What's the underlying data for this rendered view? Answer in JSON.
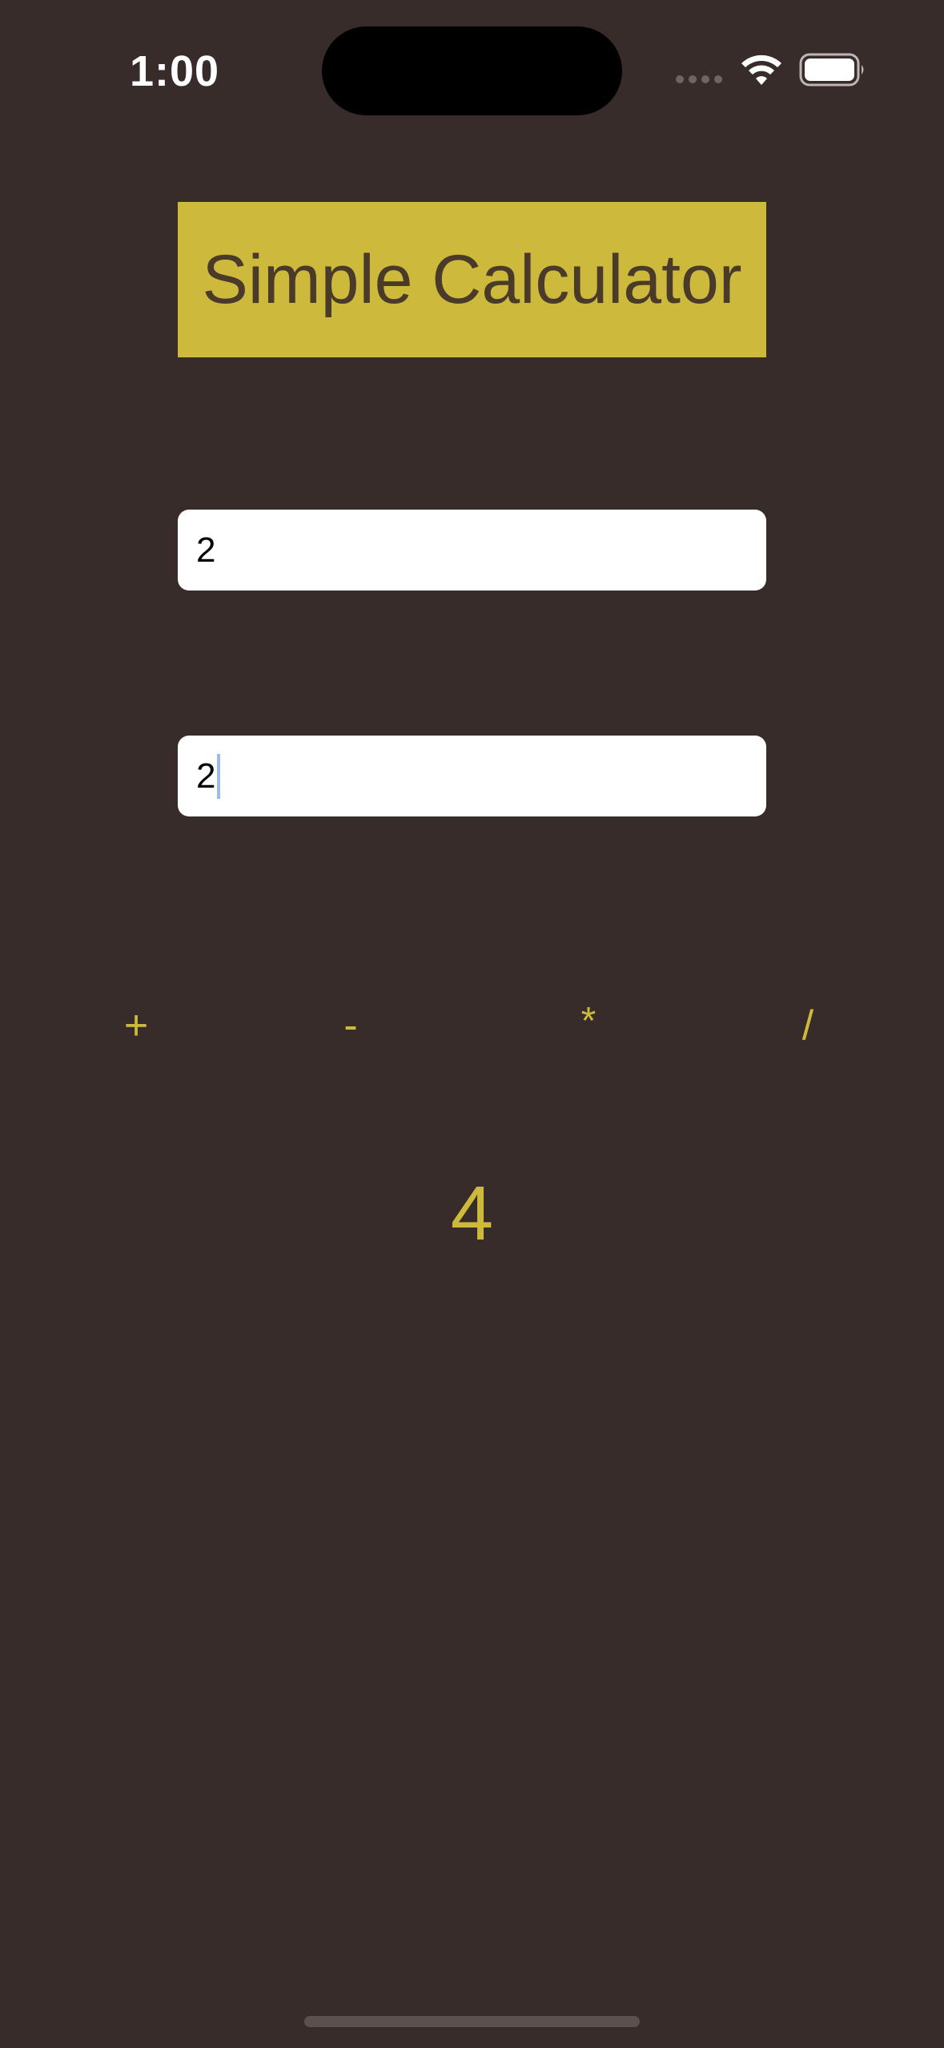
{
  "status_bar": {
    "time": "1:00",
    "signal_icon": "cellular-signal-dots-icon",
    "wifi_icon": "wifi-icon",
    "battery_icon": "battery-icon"
  },
  "app": {
    "title": "Simple Calculator"
  },
  "inputs": {
    "first_value": "2",
    "second_value": "2"
  },
  "operators": {
    "add": "+",
    "subtract": "-",
    "multiply": "*",
    "divide": "/"
  },
  "result": "4",
  "colors": {
    "background": "#372c29",
    "accent": "#cdb93b",
    "title_text": "#4a3a2a",
    "input_background": "#ffffff"
  }
}
